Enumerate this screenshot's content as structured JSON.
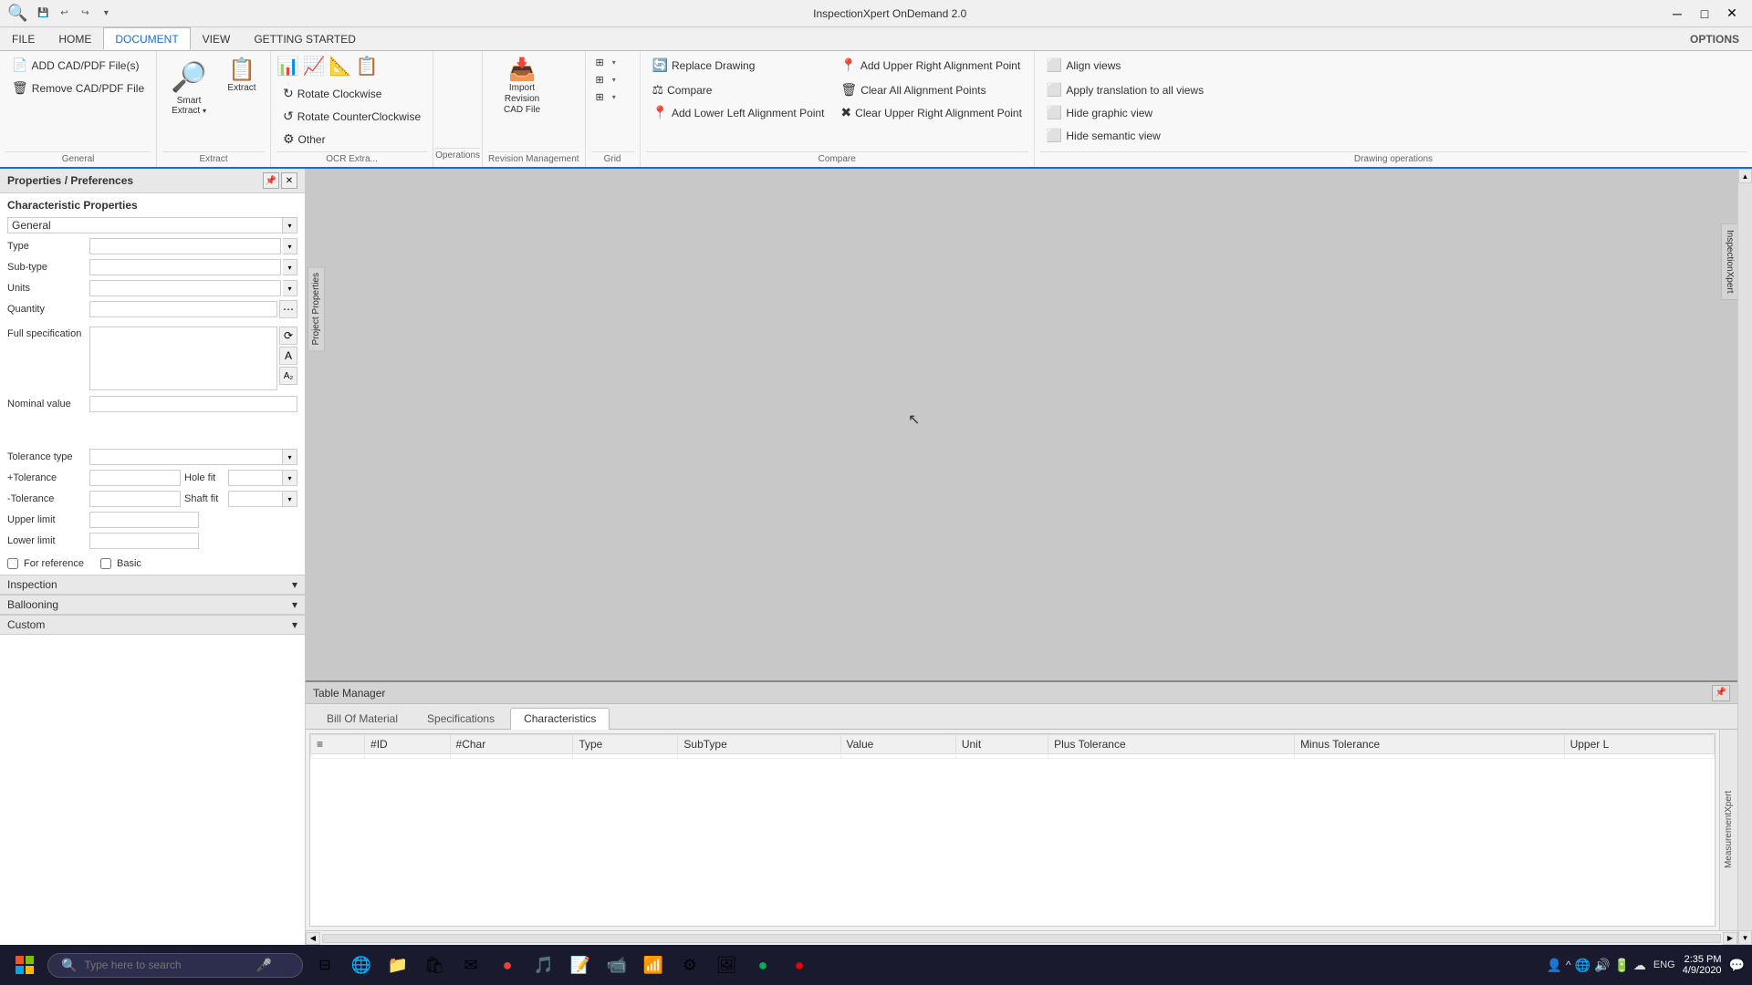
{
  "app": {
    "title": "InspectionXpert OnDemand 2.0"
  },
  "titlebar": {
    "controls": [
      "─",
      "□",
      "✕"
    ],
    "quickaccess": [
      "💾",
      "↩",
      "↪",
      "▾"
    ]
  },
  "menubar": {
    "items": [
      "FILE",
      "HOME",
      "DOCUMENT",
      "VIEW",
      "GETTING STARTED"
    ],
    "active": "DOCUMENT",
    "options": "OPTIONS"
  },
  "ribbon": {
    "groups": [
      {
        "name": "General",
        "items": [
          "ADD CAD/PDF File(s)",
          "Remove CAD/PDF File"
        ]
      },
      {
        "name": "Extract",
        "items": [
          "Smart Extract ▾",
          "Extract"
        ]
      },
      {
        "name": "OCR Extra...",
        "items": [
          "Rotate Clockwise",
          "Rotate CounterClockwise",
          "Other"
        ]
      },
      {
        "name": "Operations",
        "items": []
      },
      {
        "name": "Revision Management",
        "items": [
          "Import Revision CAD File"
        ]
      },
      {
        "name": "Grid",
        "grid_rows": [
          "row1",
          "row2",
          "row3"
        ]
      },
      {
        "name": "Compare",
        "items": [
          "Replace Drawing",
          "Compare",
          "Add Lower Left Alignment Point",
          "Add Upper Right Alignment Point",
          "Clear All Alignment Points",
          "Clear Upper Right Alignment Point"
        ]
      },
      {
        "name": "Drawing operations",
        "items": [
          "Align views",
          "Apply translation to all views",
          "Hide graphic view",
          "Hide semantic view"
        ]
      }
    ],
    "buttons": {
      "add_cad": "ADD CAD/PDF File(s)",
      "remove_cad": "Remove CAD/PDF File",
      "smart_extract": "Smart Extract",
      "extract": "Extract",
      "rotate_cw": "Rotate Clockwise",
      "rotate_ccw": "Rotate CounterClockwise",
      "other": "Other",
      "import_revision": "Import Revision CAD File",
      "replace_drawing": "Replace Drawing",
      "compare": "Compare",
      "add_lower_left": "Add Lower Left Alignment Point",
      "add_upper_right": "Add Upper Right Alignment Point",
      "clear_all": "Clear All Alignment Points",
      "clear_upper_right": "Clear Upper Right Alignment Point",
      "align_views": "Align views",
      "apply_translation": "Apply translation to all views",
      "hide_graphic": "Hide graphic view",
      "hide_semantic": "Hide semantic view"
    }
  },
  "sidebar": {
    "title": "Properties / Preferences",
    "sections": {
      "characteristic": "Characteristic Properties",
      "general": "General",
      "type_label": "Type",
      "subtype_label": "Sub-type",
      "units_label": "Units",
      "quantity_label": "Quantity",
      "full_spec_label": "Full specification",
      "nominal_label": "Nominal value",
      "tolerance_type_label": "Tolerance type",
      "plus_tolerance_label": "+Tolerance",
      "minus_tolerance_label": "-Tolerance",
      "hole_fit_label": "Hole fit",
      "shaft_fit_label": "Shaft fit",
      "upper_limit_label": "Upper limit",
      "lower_limit_label": "Lower limit",
      "for_reference_label": "For reference",
      "basic_label": "Basic",
      "inspection_label": "Inspection",
      "ballooning_label": "Ballooning",
      "custom_label": "Custom"
    },
    "project_props": "Project Properties"
  },
  "table_manager": {
    "title": "Table Manager",
    "tabs": [
      "Bill Of Material",
      "Specifications",
      "Characteristics"
    ],
    "active_tab": "Characteristics",
    "columns": [
      "#ID",
      "#Char",
      "Type",
      "SubType",
      "Value",
      "Unit",
      "Plus Tolerance",
      "Minus Tolerance",
      "Upper L"
    ]
  },
  "taskbar": {
    "search_placeholder": "Type here to search",
    "time": "2:35 PM",
    "date": "4/9/2020",
    "language": "ENG"
  },
  "side_tab": {
    "label": "InspectionXpert"
  },
  "measurement_tab": {
    "label": "MeasurementXpert"
  }
}
